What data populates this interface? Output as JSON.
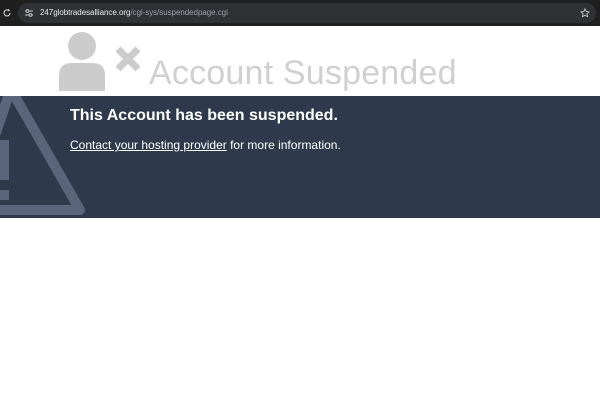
{
  "browser": {
    "url_domain": "247globtradesalliance.org",
    "url_path": "/cgi-sys/suspendedpage.cgi",
    "icons": [
      "reload-icon",
      "site-info-icon",
      "bookmark-star-icon"
    ]
  },
  "header": {
    "title": "Account Suspended",
    "logo_icon": "user-suspended-icon"
  },
  "banner": {
    "heading": "This Account has been suspended.",
    "link_text": "Contact your hosting provider",
    "message_suffix": " for more information.",
    "background_icon": "warning-triangle-icon"
  },
  "colors": {
    "toolbar": "#1f1f1f",
    "banner": "#2e3a4c",
    "title": "#d0d0d0",
    "logo": "#cccccc"
  }
}
